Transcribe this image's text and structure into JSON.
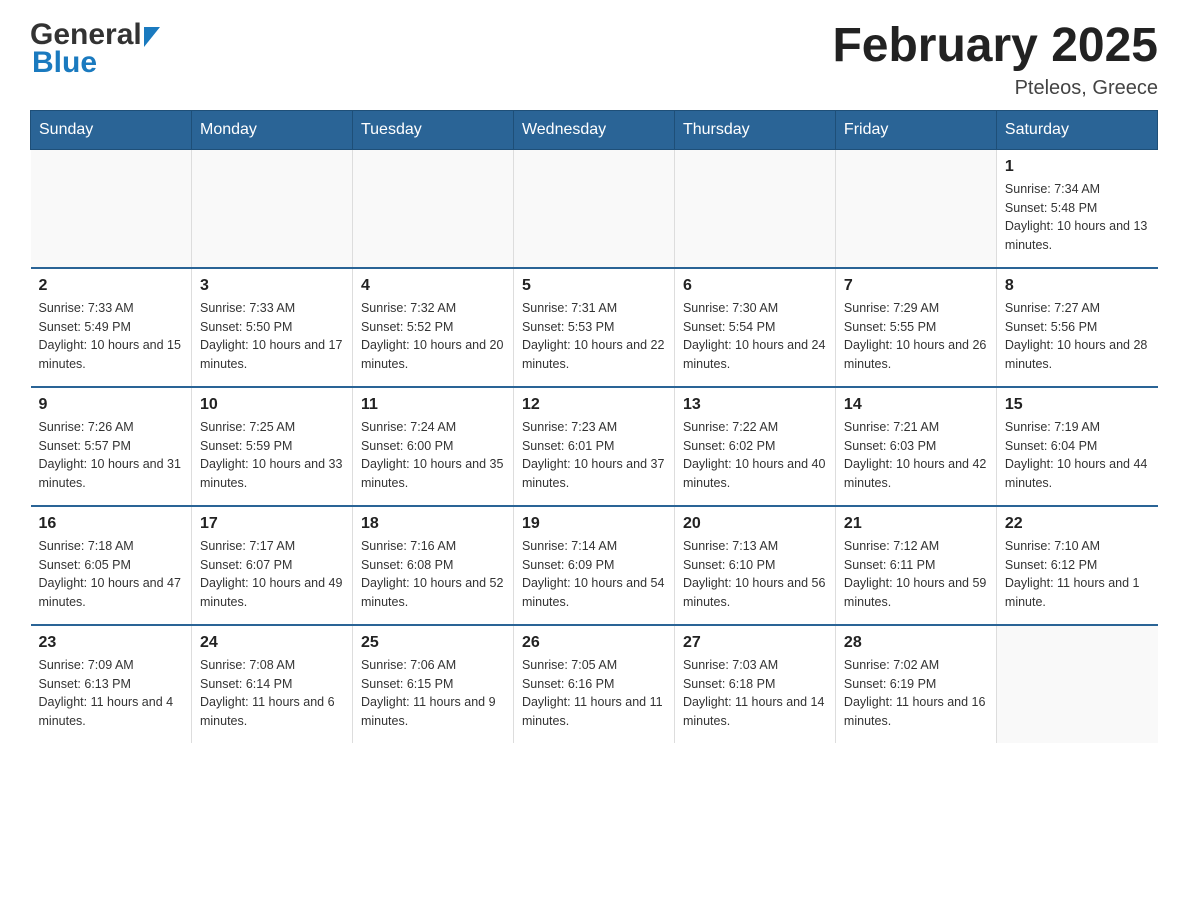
{
  "header": {
    "logo_general": "General",
    "logo_blue": "Blue",
    "month_title": "February 2025",
    "location": "Pteleos, Greece"
  },
  "weekdays": [
    "Sunday",
    "Monday",
    "Tuesday",
    "Wednesday",
    "Thursday",
    "Friday",
    "Saturday"
  ],
  "weeks": [
    [
      {
        "day": "",
        "sunrise": "",
        "sunset": "",
        "daylight": ""
      },
      {
        "day": "",
        "sunrise": "",
        "sunset": "",
        "daylight": ""
      },
      {
        "day": "",
        "sunrise": "",
        "sunset": "",
        "daylight": ""
      },
      {
        "day": "",
        "sunrise": "",
        "sunset": "",
        "daylight": ""
      },
      {
        "day": "",
        "sunrise": "",
        "sunset": "",
        "daylight": ""
      },
      {
        "day": "",
        "sunrise": "",
        "sunset": "",
        "daylight": ""
      },
      {
        "day": "1",
        "sunrise": "Sunrise: 7:34 AM",
        "sunset": "Sunset: 5:48 PM",
        "daylight": "Daylight: 10 hours and 13 minutes."
      }
    ],
    [
      {
        "day": "2",
        "sunrise": "Sunrise: 7:33 AM",
        "sunset": "Sunset: 5:49 PM",
        "daylight": "Daylight: 10 hours and 15 minutes."
      },
      {
        "day": "3",
        "sunrise": "Sunrise: 7:33 AM",
        "sunset": "Sunset: 5:50 PM",
        "daylight": "Daylight: 10 hours and 17 minutes."
      },
      {
        "day": "4",
        "sunrise": "Sunrise: 7:32 AM",
        "sunset": "Sunset: 5:52 PM",
        "daylight": "Daylight: 10 hours and 20 minutes."
      },
      {
        "day": "5",
        "sunrise": "Sunrise: 7:31 AM",
        "sunset": "Sunset: 5:53 PM",
        "daylight": "Daylight: 10 hours and 22 minutes."
      },
      {
        "day": "6",
        "sunrise": "Sunrise: 7:30 AM",
        "sunset": "Sunset: 5:54 PM",
        "daylight": "Daylight: 10 hours and 24 minutes."
      },
      {
        "day": "7",
        "sunrise": "Sunrise: 7:29 AM",
        "sunset": "Sunset: 5:55 PM",
        "daylight": "Daylight: 10 hours and 26 minutes."
      },
      {
        "day": "8",
        "sunrise": "Sunrise: 7:27 AM",
        "sunset": "Sunset: 5:56 PM",
        "daylight": "Daylight: 10 hours and 28 minutes."
      }
    ],
    [
      {
        "day": "9",
        "sunrise": "Sunrise: 7:26 AM",
        "sunset": "Sunset: 5:57 PM",
        "daylight": "Daylight: 10 hours and 31 minutes."
      },
      {
        "day": "10",
        "sunrise": "Sunrise: 7:25 AM",
        "sunset": "Sunset: 5:59 PM",
        "daylight": "Daylight: 10 hours and 33 minutes."
      },
      {
        "day": "11",
        "sunrise": "Sunrise: 7:24 AM",
        "sunset": "Sunset: 6:00 PM",
        "daylight": "Daylight: 10 hours and 35 minutes."
      },
      {
        "day": "12",
        "sunrise": "Sunrise: 7:23 AM",
        "sunset": "Sunset: 6:01 PM",
        "daylight": "Daylight: 10 hours and 37 minutes."
      },
      {
        "day": "13",
        "sunrise": "Sunrise: 7:22 AM",
        "sunset": "Sunset: 6:02 PM",
        "daylight": "Daylight: 10 hours and 40 minutes."
      },
      {
        "day": "14",
        "sunrise": "Sunrise: 7:21 AM",
        "sunset": "Sunset: 6:03 PM",
        "daylight": "Daylight: 10 hours and 42 minutes."
      },
      {
        "day": "15",
        "sunrise": "Sunrise: 7:19 AM",
        "sunset": "Sunset: 6:04 PM",
        "daylight": "Daylight: 10 hours and 44 minutes."
      }
    ],
    [
      {
        "day": "16",
        "sunrise": "Sunrise: 7:18 AM",
        "sunset": "Sunset: 6:05 PM",
        "daylight": "Daylight: 10 hours and 47 minutes."
      },
      {
        "day": "17",
        "sunrise": "Sunrise: 7:17 AM",
        "sunset": "Sunset: 6:07 PM",
        "daylight": "Daylight: 10 hours and 49 minutes."
      },
      {
        "day": "18",
        "sunrise": "Sunrise: 7:16 AM",
        "sunset": "Sunset: 6:08 PM",
        "daylight": "Daylight: 10 hours and 52 minutes."
      },
      {
        "day": "19",
        "sunrise": "Sunrise: 7:14 AM",
        "sunset": "Sunset: 6:09 PM",
        "daylight": "Daylight: 10 hours and 54 minutes."
      },
      {
        "day": "20",
        "sunrise": "Sunrise: 7:13 AM",
        "sunset": "Sunset: 6:10 PM",
        "daylight": "Daylight: 10 hours and 56 minutes."
      },
      {
        "day": "21",
        "sunrise": "Sunrise: 7:12 AM",
        "sunset": "Sunset: 6:11 PM",
        "daylight": "Daylight: 10 hours and 59 minutes."
      },
      {
        "day": "22",
        "sunrise": "Sunrise: 7:10 AM",
        "sunset": "Sunset: 6:12 PM",
        "daylight": "Daylight: 11 hours and 1 minute."
      }
    ],
    [
      {
        "day": "23",
        "sunrise": "Sunrise: 7:09 AM",
        "sunset": "Sunset: 6:13 PM",
        "daylight": "Daylight: 11 hours and 4 minutes."
      },
      {
        "day": "24",
        "sunrise": "Sunrise: 7:08 AM",
        "sunset": "Sunset: 6:14 PM",
        "daylight": "Daylight: 11 hours and 6 minutes."
      },
      {
        "day": "25",
        "sunrise": "Sunrise: 7:06 AM",
        "sunset": "Sunset: 6:15 PM",
        "daylight": "Daylight: 11 hours and 9 minutes."
      },
      {
        "day": "26",
        "sunrise": "Sunrise: 7:05 AM",
        "sunset": "Sunset: 6:16 PM",
        "daylight": "Daylight: 11 hours and 11 minutes."
      },
      {
        "day": "27",
        "sunrise": "Sunrise: 7:03 AM",
        "sunset": "Sunset: 6:18 PM",
        "daylight": "Daylight: 11 hours and 14 minutes."
      },
      {
        "day": "28",
        "sunrise": "Sunrise: 7:02 AM",
        "sunset": "Sunset: 6:19 PM",
        "daylight": "Daylight: 11 hours and 16 minutes."
      },
      {
        "day": "",
        "sunrise": "",
        "sunset": "",
        "daylight": ""
      }
    ]
  ]
}
